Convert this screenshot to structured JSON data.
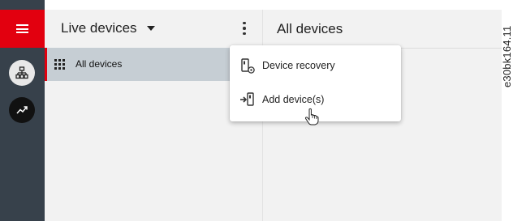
{
  "colors": {
    "brand_red": "#e2000f",
    "rail": "#37414b",
    "panel_bg": "#f2f2f2",
    "selected_bg": "#c6ced4"
  },
  "rail": {
    "menu_icon": "hamburger-icon",
    "items": [
      {
        "icon": "network-tree-icon"
      },
      {
        "icon": "trend-chart-icon"
      }
    ]
  },
  "panel": {
    "title": "Live devices",
    "more_icon": "more-vertical-icon",
    "items": [
      {
        "label": "All devices",
        "icon": "grid-icon",
        "selected": true
      }
    ]
  },
  "main": {
    "title": "All devices"
  },
  "menu": {
    "items": [
      {
        "label": "Device recovery",
        "icon": "device-recovery-icon"
      },
      {
        "label": "Add device(s)",
        "icon": "add-device-icon"
      }
    ]
  },
  "figure_id": "e30bk164.11"
}
